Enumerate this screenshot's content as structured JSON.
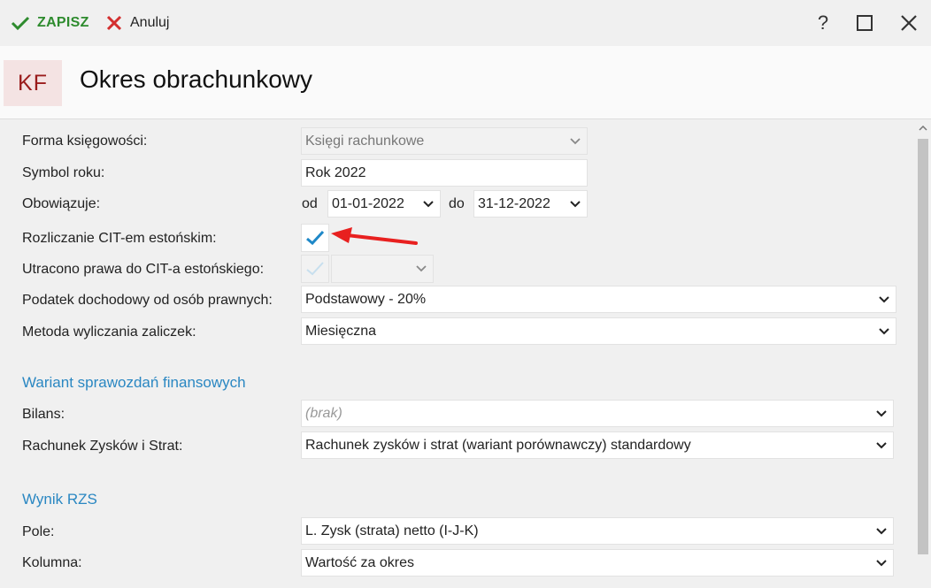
{
  "toolbar": {
    "save_label": "ZAPISZ",
    "cancel_label": "Anuluj",
    "help_label": "?"
  },
  "header": {
    "badge": "KF",
    "title": "Okres obrachunkowy"
  },
  "form": {
    "forma": {
      "label": "Forma księgowości:",
      "value": "Księgi rachunkowe"
    },
    "symbol": {
      "label": "Symbol roku:",
      "value": "Rok 2022"
    },
    "obowiazuje": {
      "label": "Obowiązuje:",
      "od": "od",
      "from": "01-01-2022",
      "do": "do",
      "to": "31-12-2022"
    },
    "cit": {
      "label": "Rozliczanie CIT-em estońskim:",
      "checked": true
    },
    "utracono": {
      "label": "Utracono prawa do CIT-a estońskiego:",
      "checked": false,
      "value": ""
    },
    "podatek": {
      "label": "Podatek dochodowy od osób prawnych:",
      "value": "Podstawowy - 20%"
    },
    "metoda": {
      "label": "Metoda wyliczania zaliczek:",
      "value": "Miesięczna"
    }
  },
  "wariant": {
    "section_title": "Wariant sprawozdań finansowych",
    "bilans": {
      "label": "Bilans:",
      "placeholder": "(brak)"
    },
    "rzs": {
      "label": "Rachunek Zysków i Strat:",
      "value": "Rachunek zysków i strat (wariant porównawczy) standardowy"
    }
  },
  "wynik": {
    "section_title": "Wynik RZS",
    "pole": {
      "label": "Pole:",
      "value": "L. Zysk (strata) netto (I-J-K)"
    },
    "kolumna": {
      "label": "Kolumna:",
      "value": "Wartość za okres"
    }
  },
  "colors": {
    "save": "#2e8b2e",
    "cancel": "#d32f2f",
    "section": "#2a87c2",
    "badge_bg": "#f4e3e3",
    "badge_fg": "#9a1b1b",
    "check": "#1e88c8",
    "arrow": "#e8201f"
  }
}
